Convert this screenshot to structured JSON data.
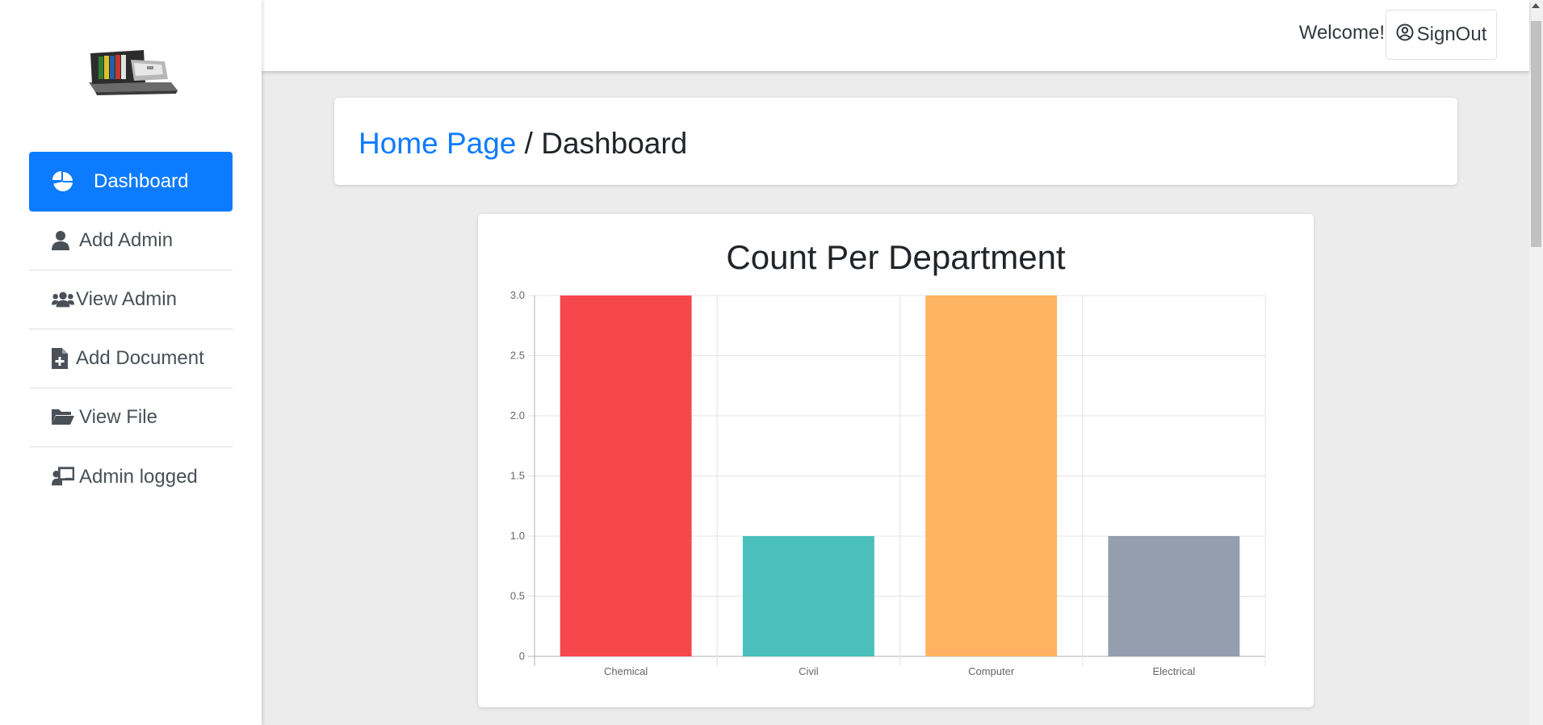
{
  "sidebar": {
    "items": [
      {
        "label": "Dashboard",
        "icon": "pie-chart-icon",
        "active": true
      },
      {
        "label": "Add Admin",
        "icon": "user-icon"
      },
      {
        "label": "View Admin",
        "icon": "users-icon"
      },
      {
        "label": "Add Document",
        "icon": "file-plus-icon"
      },
      {
        "label": "View File",
        "icon": "folder-open-icon"
      },
      {
        "label": "Admin logged",
        "icon": "chalkboard-user-icon"
      }
    ]
  },
  "header": {
    "welcome": "Welcome!",
    "signout_label": "SignOut"
  },
  "breadcrumb": {
    "home": "Home Page",
    "separator": " / ",
    "current": "Dashboard"
  },
  "colors": {
    "accent": "#0d7bff"
  },
  "chart_data": {
    "type": "bar",
    "title": "Count Per Department",
    "categories": [
      "Chemical",
      "Civil",
      "Computer",
      "Electrical"
    ],
    "values": [
      3,
      1,
      3,
      1
    ],
    "colors": [
      "#f5474c",
      "#4abfbc",
      "#fdb35f",
      "#949eaf"
    ],
    "ylim": [
      0,
      3
    ],
    "yticks": [
      "0",
      "0.5",
      "1.0",
      "1.5",
      "2.0",
      "2.5",
      "3.0"
    ],
    "grid": true
  }
}
